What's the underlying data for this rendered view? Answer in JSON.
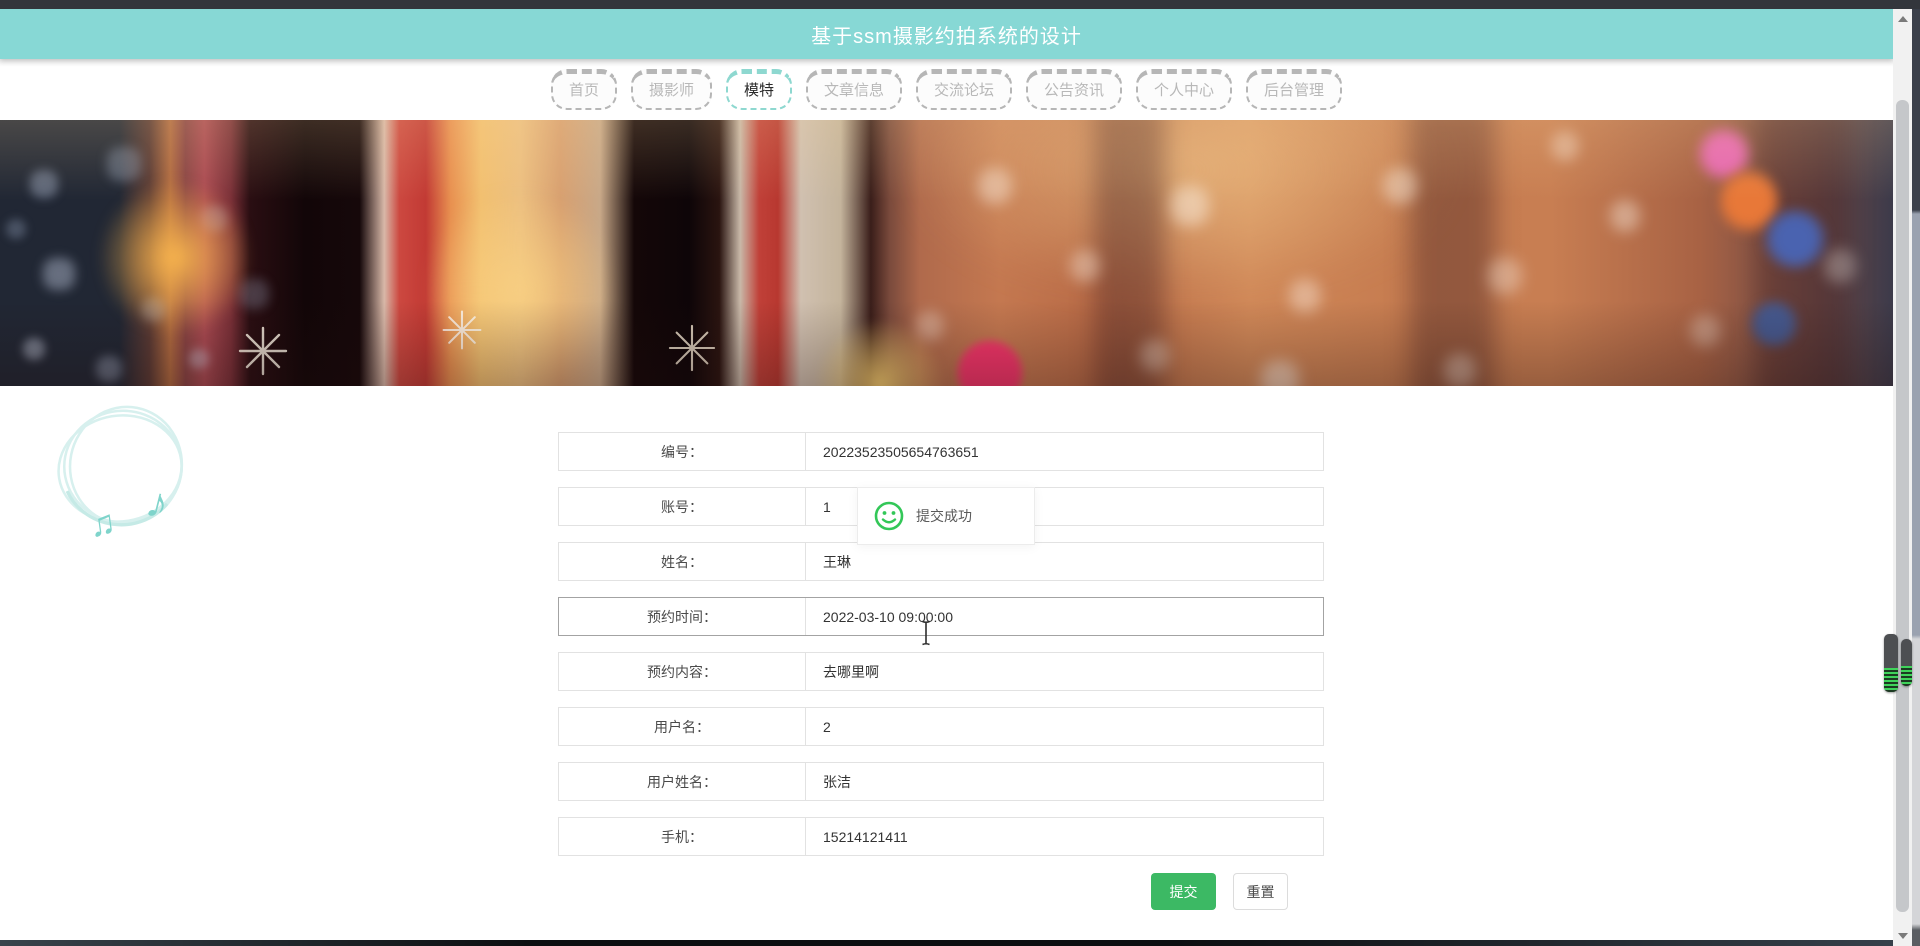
{
  "header": {
    "title": "基于ssm摄影约拍系统的设计"
  },
  "nav": {
    "tabs": [
      {
        "label": "首页",
        "active": false
      },
      {
        "label": "摄影师",
        "active": false
      },
      {
        "label": "模特",
        "active": true
      },
      {
        "label": "文章信息",
        "active": false
      },
      {
        "label": "交流论坛",
        "active": false
      },
      {
        "label": "公告资讯",
        "active": false
      },
      {
        "label": "个人中心",
        "active": false
      },
      {
        "label": "后台管理",
        "active": false
      }
    ]
  },
  "form": {
    "rows": [
      {
        "label": "编号：",
        "value": "20223523505654763651"
      },
      {
        "label": "账号：",
        "value": "1"
      },
      {
        "label": "姓名：",
        "value": "王琳"
      },
      {
        "label": "预约时间：",
        "value": "2022-03-10 09:00:00",
        "focused": true
      },
      {
        "label": "预约内容：",
        "value": "去哪里啊"
      },
      {
        "label": "用户名：",
        "value": "2"
      },
      {
        "label": "用户姓名：",
        "value": "张洁"
      },
      {
        "label": "手机：",
        "value": "15214121411"
      }
    ],
    "submit_label": "提交",
    "reset_label": "重置"
  },
  "toast": {
    "message": "提交成功",
    "icon": "smiley-success-icon"
  },
  "colors": {
    "header_teal": "#87d8d5",
    "accent_teal": "#8ed8d0",
    "submit_green": "#3cb964",
    "toast_icon_green": "#33c758"
  }
}
